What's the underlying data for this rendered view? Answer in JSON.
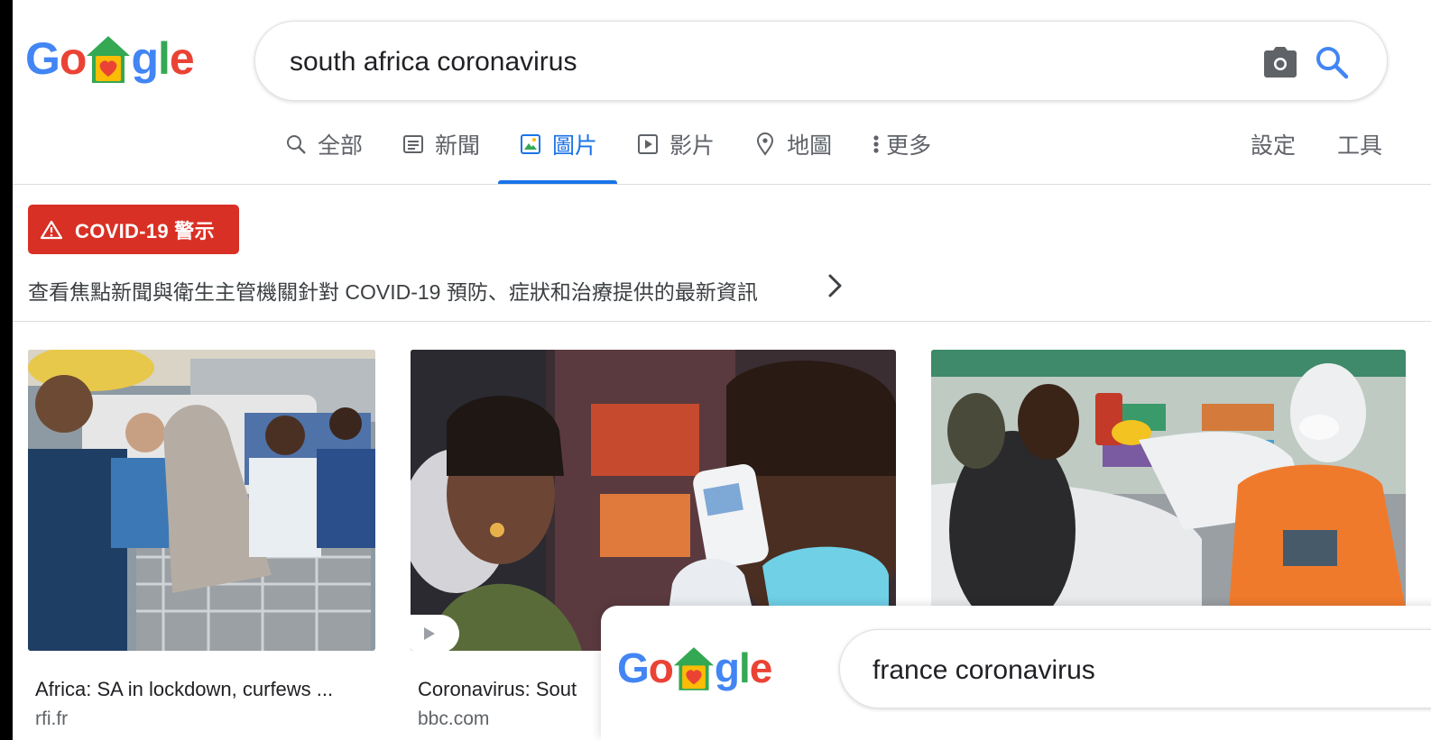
{
  "header": {
    "logo": {
      "letters": [
        "G",
        "o",
        "g",
        "l",
        "e"
      ]
    },
    "search": {
      "query": "south africa coronavirus"
    },
    "tabs": [
      {
        "label": "全部",
        "icon": "search-icon"
      },
      {
        "label": "新聞",
        "icon": "newspaper-icon"
      },
      {
        "label": "圖片",
        "icon": "image-icon",
        "active": true
      },
      {
        "label": "影片",
        "icon": "play-icon"
      },
      {
        "label": "地圖",
        "icon": "map-pin-icon"
      },
      {
        "label": "更多",
        "icon": "more-vert-icon"
      }
    ],
    "settings_label": "設定",
    "tools_label": "工具"
  },
  "covid": {
    "badge_label": "COVID-19 警示",
    "message": "查看焦點新聞與衛生主管機關針對 COVID-19 預防、症狀和治療提供的最新資訊"
  },
  "results": [
    {
      "title": "Africa: SA in lockdown, curfews ...",
      "source": "rfi.fr"
    },
    {
      "title": "Coronavirus: Sout",
      "source": "bbc.com",
      "video": true
    },
    {
      "title": "",
      "source": ""
    }
  ],
  "overlay": {
    "search": {
      "query": "france coronavirus"
    }
  },
  "colors": {
    "google_blue": "#4285f4",
    "google_red": "#ea4335",
    "google_yellow": "#fbbc05",
    "google_green": "#34a853",
    "active_tab": "#1a73e8",
    "alert_red": "#d93025"
  }
}
